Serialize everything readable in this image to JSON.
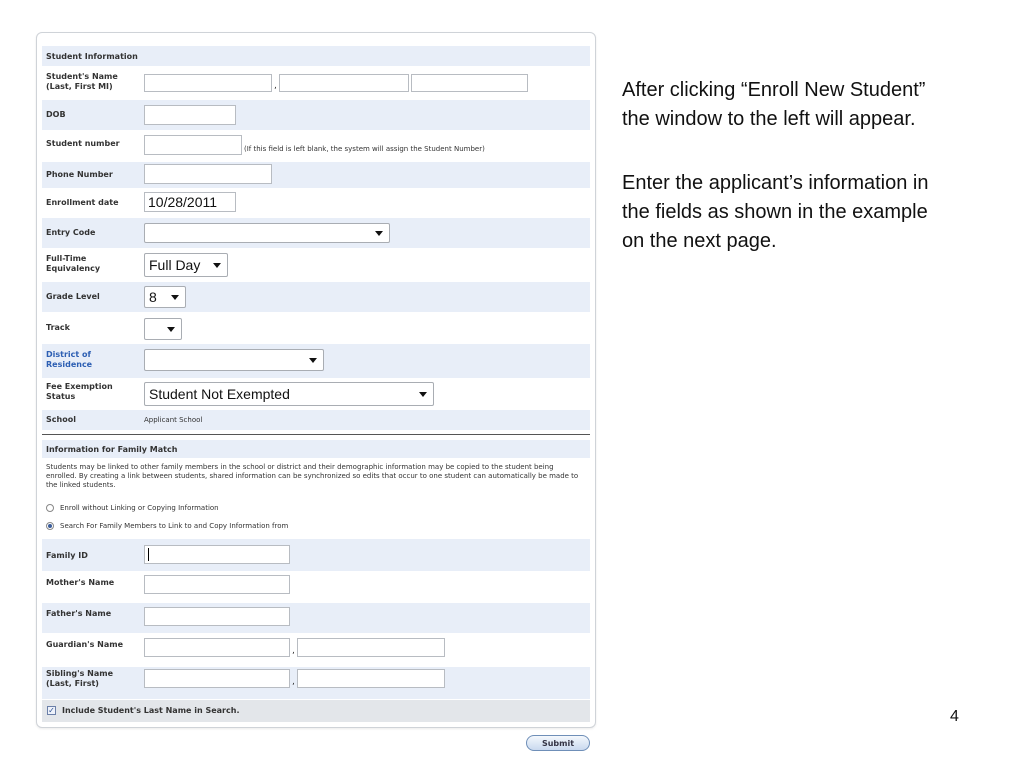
{
  "form": {
    "student_info_title": "Student Information",
    "fields": {
      "name_label": "Student's Name (Last, First MI)",
      "name_comma": ",",
      "dob_label": "DOB",
      "student_number_label": "Student number",
      "student_number_hint": "(If this field is left blank, the system will assign the Student Number)",
      "phone_label": "Phone Number",
      "enroll_date_label": "Enrollment date",
      "enroll_date_value": "10/28/2011",
      "entry_code_label": "Entry Code",
      "entry_code_value": "",
      "fte_label": "Full-Time Equivalency",
      "fte_value": "Full Day",
      "grade_label": "Grade Level",
      "grade_value": "8",
      "track_label": "Track",
      "track_value": "",
      "district_label": "District of Residence",
      "district_value": "",
      "fee_label": "Fee Exemption Status",
      "fee_value": "Student Not Exempted",
      "school_label": "School",
      "school_value": "Applicant School"
    },
    "family_title": "Information for Family Match",
    "family_note": "Students may be linked to other family members in the school or district and their demographic information may be copied to the student being enrolled. By creating a link between students, shared information can be synchronized so edits that occur to one student can automatically be made to the linked students.",
    "radio_enroll_without": "Enroll without Linking or Copying Information",
    "radio_search": "Search For Family Members to Link to and Copy Information from",
    "family_fields": {
      "family_id_label": "Family ID",
      "mother_label": "Mother's Name",
      "father_label": "Father's Name",
      "guardian_label": "Guardian's Name",
      "sibling_label": "Sibling's Name (Last, First)",
      "comma": ","
    },
    "include_last_name": "Include Student's Last Name in Search.",
    "submit_label": "Submit"
  },
  "instructions": {
    "line1": "After clicking “Enroll New Student”",
    "line2": "the window to the left will appear.",
    "line3": "Enter the applicant’s information in",
    "line4": "the fields as shown in the example",
    "line5": "on the next page."
  },
  "page_number": "4"
}
